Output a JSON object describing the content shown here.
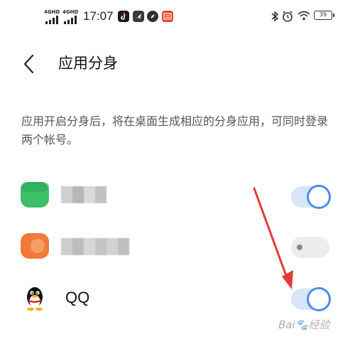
{
  "status_bar": {
    "network_1": "4GHD",
    "network_2": "4GHD",
    "time": "17:07",
    "battery": "39"
  },
  "header": {
    "title": "应用分身"
  },
  "description": "应用开启分身后，将在桌面生成相应的分身应用，可同时登录两个帐号。",
  "apps": [
    {
      "icon": "green-app-icon",
      "name": "",
      "enabled": true
    },
    {
      "icon": "orange-app-icon",
      "name": "",
      "enabled": false
    },
    {
      "icon": "qq-penguin-icon",
      "name": "QQ",
      "enabled": true
    }
  ],
  "colors": {
    "accent": "#4c8de6",
    "arrow": "#e53935"
  }
}
